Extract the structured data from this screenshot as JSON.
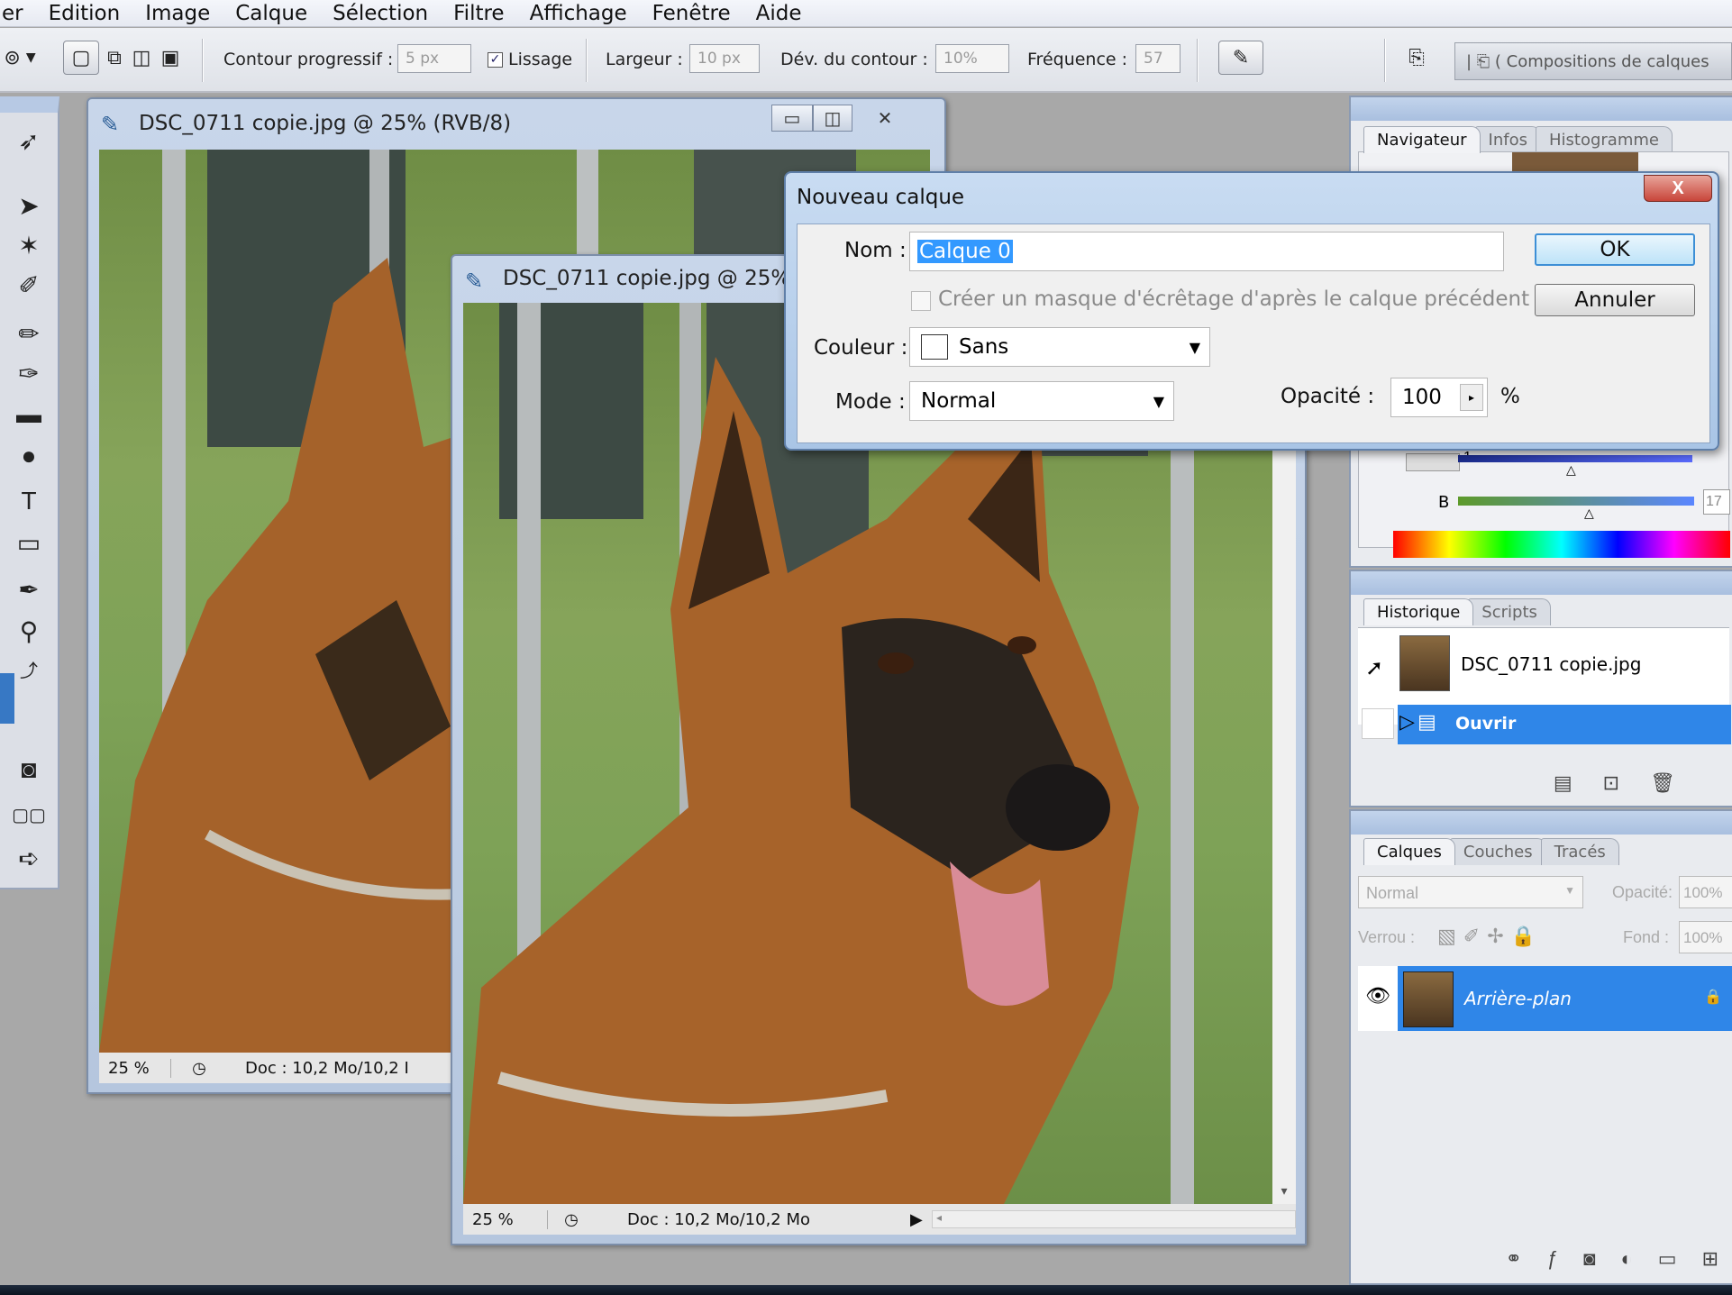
{
  "menu": {
    "items": [
      "er",
      "Edition",
      "Image",
      "Calque",
      "Sélection",
      "Filtre",
      "Affichage",
      "Fenêtre",
      "Aide"
    ]
  },
  "options_bar": {
    "feather_label": "Contour progressif :",
    "feather_value": "5 px",
    "antialias_label": "Lissage",
    "antialias_checked": true,
    "width_label": "Largeur :",
    "width_value": "10 px",
    "contrast_label": "Dév. du contour :",
    "contrast_value": "10%",
    "frequency_label": "Fréquence :",
    "frequency_value": "57",
    "compositions_label": "Compositions de calques"
  },
  "doc_window_back": {
    "title": "DSC_0711 copie.jpg @ 25% (RVB/8)",
    "zoom": "25 %",
    "doc_size": "Doc : 10,2 Mo/10,2 I"
  },
  "doc_window_front": {
    "title": "DSC_0711 copie.jpg @ 25% (",
    "zoom": "25 %",
    "doc_size": "Doc : 10,2 Mo/10,2 Mo"
  },
  "dialog": {
    "title": "Nouveau calque",
    "name_label": "Nom :",
    "name_value": "Calque 0",
    "clip_checkbox_label": "Créer un masque d'écrêtage d'après le calque précédent",
    "clip_checked": false,
    "color_label": "Couleur :",
    "color_value": "Sans",
    "mode_label": "Mode :",
    "mode_value": "Normal",
    "opacity_label": "Opacité :",
    "opacity_value": "100",
    "opacity_unit": "%",
    "ok_label": "OK",
    "cancel_label": "Annuler",
    "close_glyph": "X"
  },
  "navigator_panel": {
    "tabs": [
      "Navigateur",
      "Infos",
      "Histogramme"
    ],
    "active_tab": "Navigateur",
    "channel_b_label": "B",
    "channel_value_1": "1",
    "channel_value_2": "17"
  },
  "history_panel": {
    "tabs": [
      "Historique",
      "Scripts"
    ],
    "snapshot_label": "DSC_0711 copie.jpg",
    "step_label": "Ouvrir"
  },
  "layers_panel": {
    "tabs": [
      "Calques",
      "Couches",
      "Tracés"
    ],
    "blend_mode": "Normal",
    "opacity_label": "Opacité:",
    "opacity_value": "100%",
    "lock_label": "Verrou :",
    "fill_label": "Fond :",
    "fill_value": "100%",
    "layer_name": "Arrière-plan"
  },
  "colors": {
    "selection_blue": "#2f86e8",
    "title_blue": "#b5c6de",
    "close_red": "#c8453a"
  }
}
